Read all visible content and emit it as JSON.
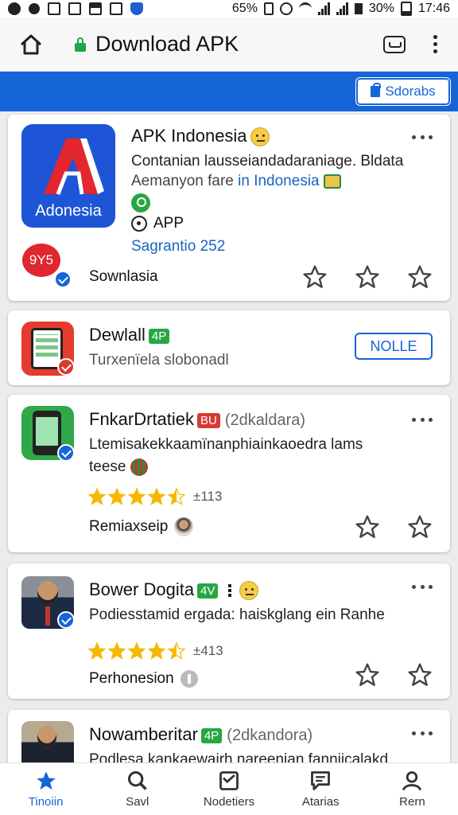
{
  "status_bar": {
    "battery_text": "65%",
    "battery_pct": "30%",
    "time": "17:46"
  },
  "browser": {
    "page_title": "Download APK"
  },
  "banner": {
    "button_label": "Sdorabs"
  },
  "colors": {
    "accent": "#1565d8",
    "badge_green": "#27a744",
    "badge_red": "#d93a2f",
    "star_gold": "#f5b800"
  },
  "apps": [
    {
      "name": "APK Indonesia",
      "icon_label": "Adonesia",
      "desc1": "Contanian lausseiandadaraniage. Bldata",
      "desc2_prefix": "Aemanyon fare",
      "desc2_link": "in Indonesia",
      "app_tag": "APP",
      "link": "Sagrantio 252",
      "review_badge": "9Y5",
      "footer": "Sownlasia"
    },
    {
      "name": "Dewlall",
      "badge": "4P",
      "desc": "Turxenïela slobonadl",
      "action": "NOLLE"
    },
    {
      "name": "FnkarDrtatiek",
      "badge": "BU",
      "sub": "(2dkaldara)",
      "desc1": "Ltemisakekkaamïnanphiainkaoedra lams",
      "desc2": "teese",
      "rating": 4.5,
      "rating_count": "±113",
      "footer": "Remiaxseip"
    },
    {
      "name": "Bower Dogita",
      "badge": "4V",
      "desc": "Podiesstamid ergada: haiskglang ein Ranhe",
      "rating": 4.5,
      "rating_count": "±413",
      "footer": "Perhonesion"
    },
    {
      "name": "Nowamberitar",
      "badge": "4P",
      "sub": "(2dkandora)",
      "desc": "Podlesa kankaewairh nareenian fanniicalakd"
    }
  ],
  "bottom_nav": [
    {
      "label": "Tinoiin",
      "icon": "star-icon"
    },
    {
      "label": "Savl",
      "icon": "search-icon"
    },
    {
      "label": "Nodetiers",
      "icon": "inbox-icon"
    },
    {
      "label": "Atarias",
      "icon": "chat-icon"
    },
    {
      "label": "Rern",
      "icon": "profile-icon"
    }
  ]
}
